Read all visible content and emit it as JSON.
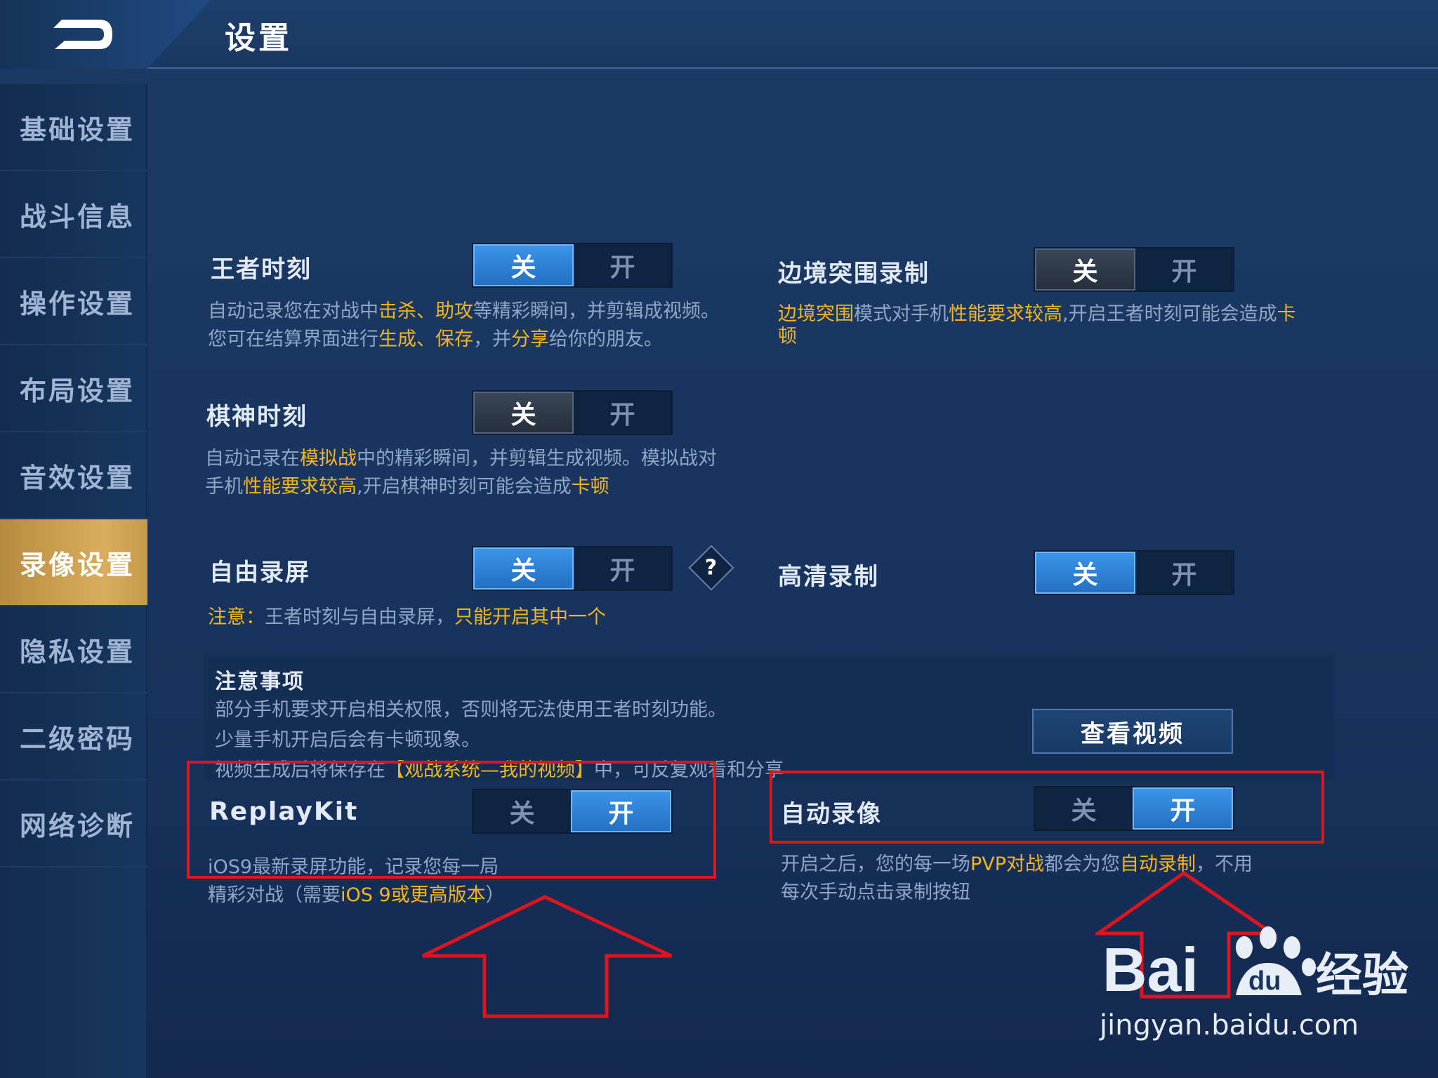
{
  "header": {
    "title": "设置",
    "back_icon": "back-arrow-icon"
  },
  "sidebar": {
    "items": [
      {
        "label": "基础设置",
        "active": false
      },
      {
        "label": "战斗信息",
        "active": false
      },
      {
        "label": "操作设置",
        "active": false
      },
      {
        "label": "布局设置",
        "active": false
      },
      {
        "label": "音效设置",
        "active": false
      },
      {
        "label": "录像设置",
        "active": true
      },
      {
        "label": "隐私设置",
        "active": false
      },
      {
        "label": "二级密码",
        "active": false
      },
      {
        "label": "网络诊断",
        "active": false
      }
    ]
  },
  "toggle_labels": {
    "off": "关",
    "on": "开"
  },
  "settings": {
    "wangzhe_moment": {
      "label": "王者时刻",
      "value": "关",
      "desc_parts": [
        "自动记录您在对战中",
        "击杀、助攻",
        "等精彩瞬间，并剪辑成视频。",
        "您可在结算界面进行",
        "生成、保存",
        "，并",
        "分享",
        "给你的朋友。"
      ]
    },
    "border_breakout": {
      "label": "边境突围录制",
      "value": "关",
      "desc_parts": [
        "边境突围",
        "模式对手机",
        "性能要求较高",
        ",开启王者时刻可能会造成",
        "卡",
        "顿"
      ]
    },
    "chess_moment": {
      "label": "棋神时刻",
      "value": "关",
      "desc_parts": [
        "自动记录在",
        "模拟战",
        "中的精彩瞬间，并剪辑生成视频。模拟战对",
        "手机",
        "性能要求较高",
        ",开启棋神时刻可能会造成",
        "卡顿"
      ]
    },
    "free_record": {
      "label": "自由录屏",
      "value": "关",
      "help": "?",
      "desc_parts": [
        "注意：",
        "王者时刻与自由录屏，",
        "只能开启其中一个"
      ]
    },
    "hd_record": {
      "label": "高清录制",
      "value": "关"
    },
    "notes": {
      "title": "注意事项",
      "line1": "部分手机要求开启相关权限，否则将无法使用王者时刻功能。",
      "line2": "少量手机开启后会有卡顿现象。",
      "line3_parts": [
        "视频生成后将保存在",
        "【观战系统—我的视频】",
        "中，可反复观看和分享"
      ],
      "view_button": "查看视频"
    },
    "replaykit": {
      "label": "ReplayKit",
      "value": "开",
      "desc_parts": [
        "iOS9最新录屏功能，记录您每一局",
        "精彩对战（需要",
        "iOS 9或更高版本",
        "）"
      ]
    },
    "auto_record": {
      "label": "自动录像",
      "value": "开",
      "desc_parts": [
        "开启之后，您的每一场",
        "PVP对战",
        "都会为您",
        "自动录制",
        "，不用",
        "每次手动点击录制按钮"
      ]
    }
  },
  "watermark": {
    "brand": "Bai",
    "brand2": "du",
    "brand_cn": "经验",
    "url": "jingyan.baidu.com"
  },
  "colors": {
    "highlight": "#f1b61f",
    "toggle_blue": "#2f84d8",
    "active_tab": "#c99b4b",
    "annotation_red": "#e0141c"
  }
}
